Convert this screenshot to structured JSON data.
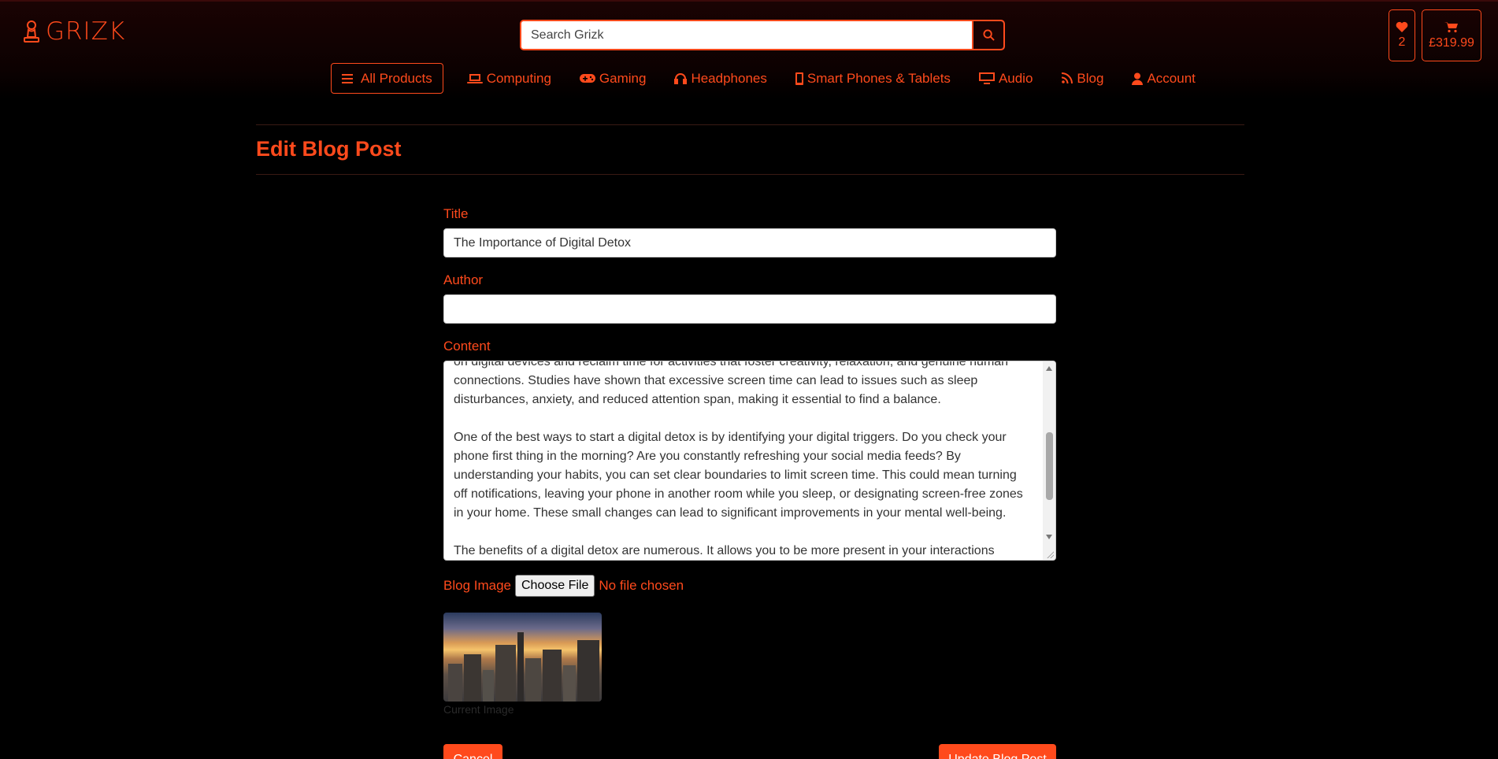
{
  "header": {
    "logo_text": "GRIZK",
    "search_placeholder": "Search Grizk",
    "wishlist_count": "2",
    "cart_total": "£319.99"
  },
  "nav": {
    "all_products": "All Products",
    "items": [
      {
        "label": "Computing",
        "icon": "laptop-icon"
      },
      {
        "label": "Gaming",
        "icon": "gamepad-icon"
      },
      {
        "label": "Headphones",
        "icon": "headphones-icon"
      },
      {
        "label": "Smart Phones & Tablets",
        "icon": "phone-icon"
      },
      {
        "label": "Audio",
        "icon": "tv-icon"
      },
      {
        "label": "Blog",
        "icon": "blog-icon"
      },
      {
        "label": "Account",
        "icon": "user-icon"
      }
    ]
  },
  "page": {
    "title": "Edit Blog Post"
  },
  "form": {
    "title_label": "Title",
    "title_value": "The Importance of Digital Detox",
    "author_label": "Author",
    "author_value": "",
    "content_label": "Content",
    "content_value": "on digital devices and reclaim time for activities that foster creativity, relaxation, and genuine human connections. Studies have shown that excessive screen time can lead to issues such as sleep disturbances, anxiety, and reduced attention span, making it essential to find a balance.\n\nOne of the best ways to start a digital detox is by identifying your digital triggers. Do you check your phone first thing in the morning? Are you constantly refreshing your social media feeds? By understanding your habits, you can set clear boundaries to limit screen time. This could mean turning off notifications, leaving your phone in another room while you sleep, or designating screen-free zones in your home. These small changes can lead to significant improvements in your mental well-being.\n\nThe benefits of a digital detox are numerous. It allows you to be more present in your interactions",
    "image_label": "Blog Image",
    "choose_file": "Choose File",
    "no_file": "No file chosen",
    "current_image_caption": "Current Image",
    "cancel": "Cancel",
    "update": "Update Blog Post"
  },
  "colors": {
    "accent": "#ff4a1c",
    "background": "#000000"
  }
}
